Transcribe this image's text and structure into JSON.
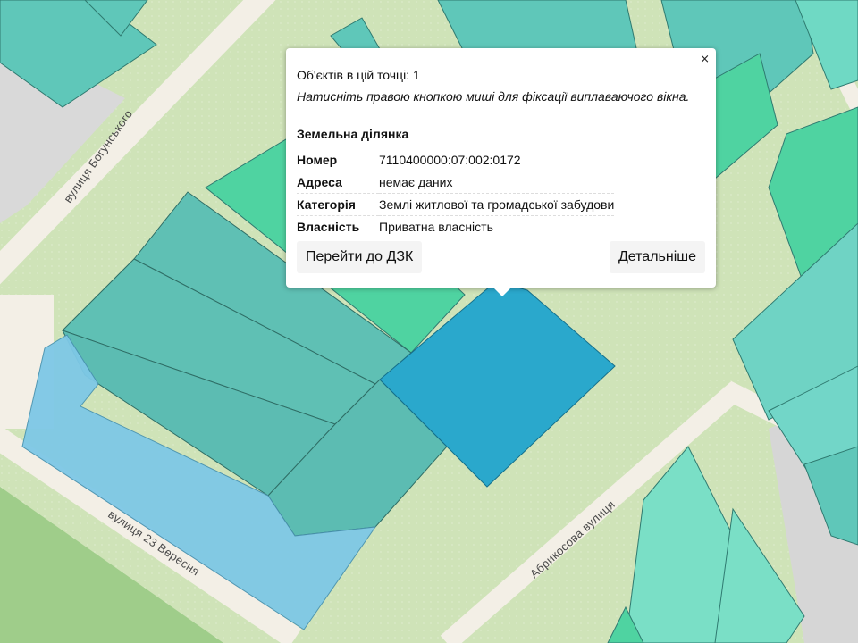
{
  "map": {
    "streets": {
      "bohunskoho": "вулиця Богунського",
      "veresnia": "вулиця 23 Вересня",
      "abrykosova": "Абрикосова вулиця"
    },
    "colors": {
      "background": "#cfe3b8",
      "road": "#f3efe6",
      "parcel_teal": "#5fc7b9",
      "parcel_green": "#4fd3a1",
      "parcel_blue": "#7ec8e6",
      "selected": "#2aa8cc",
      "park": "#9fcd8a"
    }
  },
  "popup": {
    "objects_count": "Об'єктів в цій точці: 1",
    "hint": "Натисніть правою кнопкою миші для фіксації виплаваючого вікна.",
    "section_title": "Земельна ділянка",
    "rows": [
      {
        "key": "Номер",
        "value": "7110400000:07:002:0172"
      },
      {
        "key": "Адреса",
        "value": "немає даних"
      },
      {
        "key": "Категорія",
        "value": "Землі житлової та громадської забудови"
      },
      {
        "key": "Власність",
        "value": "Приватна власність"
      }
    ],
    "goto_button": "Перейти до ДЗК",
    "details_button": "Детальніше",
    "close_icon": "×"
  }
}
